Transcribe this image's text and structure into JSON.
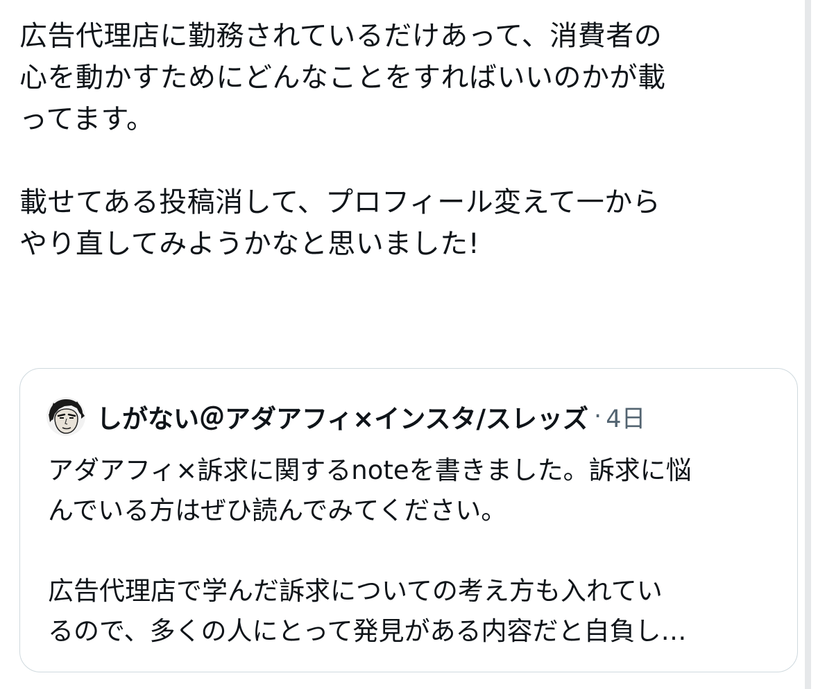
{
  "post": {
    "lines": [
      "広告代理店に勤務されているだけあって、消費者の",
      "心を動かすためにどんなことをすればいいのかが載",
      "ってます。",
      "載せてある投稿消して、プロフィール変えて一から",
      "やり直してみようかなと思いました!"
    ]
  },
  "quoted_post": {
    "author_name": "しがない＠アダアフィ×インスタ/スレッズ",
    "separator": "·",
    "time": "4日",
    "avatar_icon": "manga-character-avatar",
    "lines": [
      "アダアフィ×訴求に関するnoteを書きました。訴求に悩",
      "んでいる方はぜひ読んでみてください。",
      "広告代理店で学んだ訴求についての考え方も入れてい",
      "るので、多くの人にとって発見がある内容だと自負し…"
    ]
  },
  "colors": {
    "text_primary": "#0f1419",
    "text_secondary": "#536471",
    "card_border": "#cfd9de"
  }
}
